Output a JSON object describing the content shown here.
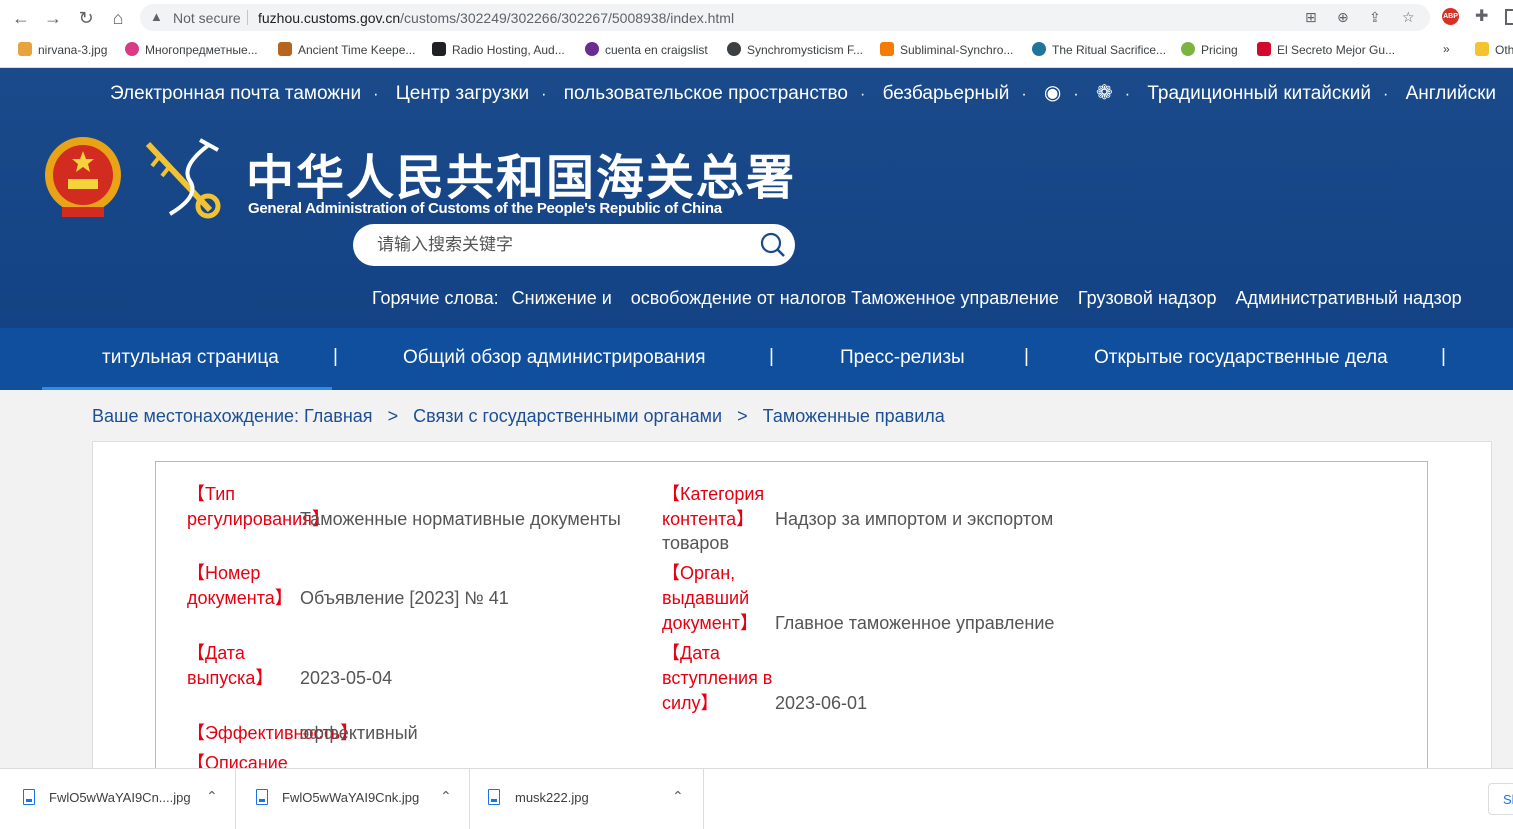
{
  "browser": {
    "not_secure": "Not secure",
    "url_host": "fuzhou.customs.gov.cn",
    "url_path": "/customs/302249/302266/302267/5008938/index.html",
    "bookmarks": [
      {
        "label": "nirvana-3.jpg",
        "color": "#e8a33d"
      },
      {
        "label": "Многопредметные...",
        "color": "#d93b84"
      },
      {
        "label": "Ancient Time Keepe...",
        "color": "#b5651d"
      },
      {
        "label": "Radio Hosting, Aud...",
        "color": "#202124"
      },
      {
        "label": "cuenta en craigslist",
        "color": "#6a2c91"
      },
      {
        "label": "Synchromysticism F...",
        "color": "#3c4043"
      },
      {
        "label": "Subliminal-Synchro...",
        "color": "#f57c00"
      },
      {
        "label": "The Ritual Sacrifice...",
        "color": "#21759b"
      },
      {
        "label": "Pricing",
        "color": "#7cb342"
      },
      {
        "label": "El Secreto Mejor Gu...",
        "color": "#cf0a2c"
      },
      {
        "label": "Oth",
        "color": "#f4c430"
      }
    ],
    "more_bookmarks": "»"
  },
  "header": {
    "top_links": [
      "Электронная почта таможни",
      "Центр загрузки",
      "пользовательское пространство",
      "безбарьерный",
      "Традиционный китайский",
      "Английски"
    ],
    "site_title": "中华人民共和国海关总署",
    "site_subtitle": "General Administration of Customs of the People's Republic of China",
    "search_placeholder": "请输入搜索关键字",
    "hot_words_label": "Горячие слова:",
    "hot_words": [
      "Снижение и",
      "освобождение от налогов Таможенное управление",
      "Грузовой надзор",
      "Административный надзор"
    ]
  },
  "main_nav": {
    "items": [
      "титульная страница",
      "Общий обзор администрирования",
      "Пресс-релизы",
      "Открытые государственные дела"
    ],
    "separator": "|"
  },
  "breadcrumb": {
    "prefix": "Ваше местонахождение:",
    "home": "Главная",
    "level1": "Связи с государственными органами",
    "level2": "Таможенные правила",
    "arrow": ">"
  },
  "info": {
    "type_label": "【Тип регулирования】",
    "type_value": "Таможенные нормативные документы",
    "category_label": "【Категория контента】",
    "category_value_line1": "Надзор за импортом и экспортом",
    "category_value_line2": "товаров",
    "docnum_label": "【Номер документа】",
    "docnum_value": "Объявление [2023] № 41",
    "issuer_label": "【Орган, выдавший документ】",
    "issuer_value": "Главное таможенное управление",
    "issue_date_label": "【Дата выпуска】",
    "issue_date_value": "2023-05-04",
    "effective_date_label": "【Дата вступления в силу】",
    "effective_date_value": "2023-06-01",
    "validity_label": "【Эффективность】",
    "validity_value": "эффективный",
    "description_label": "【Описание"
  },
  "downloads": {
    "items": [
      "FwlO5wWaYAI9Cn....jpg",
      "FwlO5wWaYAI9Cnk.jpg",
      "musk222.jpg"
    ],
    "show_all": "Sh"
  },
  "colors": {
    "header_blue": "#1a4a8a",
    "nav_blue": "#0f4f9e",
    "label_red": "#e60012",
    "link_blue": "#1d4f96"
  }
}
